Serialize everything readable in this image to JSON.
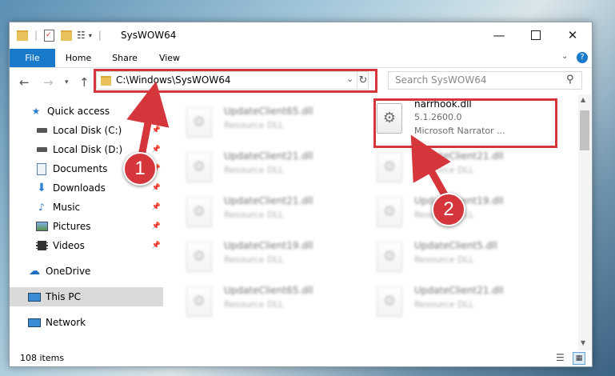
{
  "window": {
    "title": "SysWOW64"
  },
  "ribbon": {
    "file": "File",
    "home": "Home",
    "share": "Share",
    "view": "View"
  },
  "address": {
    "path": "C:\\Windows\\SysWOW64"
  },
  "search": {
    "placeholder": "Search SysWOW64"
  },
  "nav": {
    "quick_access": "Quick access",
    "items": [
      {
        "label": "Local Disk (C:)",
        "icon": "drive-icon"
      },
      {
        "label": "Local Disk (D:)",
        "icon": "drive-icon"
      },
      {
        "label": "Documents",
        "icon": "documents-icon"
      },
      {
        "label": "Downloads",
        "icon": "downloads-icon"
      },
      {
        "label": "Music",
        "icon": "music-icon"
      },
      {
        "label": "Pictures",
        "icon": "pictures-icon"
      },
      {
        "label": "Videos",
        "icon": "videos-icon"
      }
    ],
    "onedrive": "OneDrive",
    "this_pc": "This PC",
    "network": "Network"
  },
  "files": {
    "highlighted": {
      "name": "narrhook.dll",
      "version": "5.1.2600.0",
      "desc": "Microsoft Narrator ..."
    },
    "left_column": [
      {
        "name": "UpdateClient65.dll",
        "desc": "Resource DLL"
      },
      {
        "name": "UpdateClient21.dll",
        "desc": "Resource DLL"
      },
      {
        "name": "UpdateClient21.dll",
        "desc": "Resource DLL"
      },
      {
        "name": "UpdateClient19.dll",
        "desc": "Resource DLL"
      },
      {
        "name": "UpdateClient65.dll",
        "desc": "Resource DLL"
      }
    ],
    "right_column": [
      {
        "name": "UpdateClient21.dll",
        "desc": "Resource DLL"
      },
      {
        "name": "UpdateClient19.dll",
        "desc": "Resource DLL"
      },
      {
        "name": "UpdateClient5.dll",
        "desc": "Resource DLL"
      },
      {
        "name": "UpdateClient21.dll",
        "desc": "Resource DLL"
      }
    ]
  },
  "status": {
    "count": "108 items"
  },
  "annotations": {
    "step1": "1",
    "step2": "2"
  },
  "colors": {
    "accent": "#1979ca",
    "highlight": "#d4363c"
  }
}
